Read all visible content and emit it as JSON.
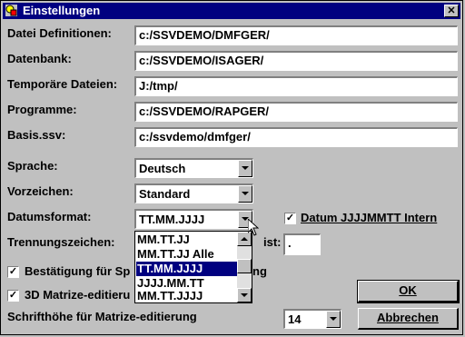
{
  "window": {
    "title": "Einstellungen",
    "close_glyph": "✕"
  },
  "paths": {
    "datei_definitionen": {
      "label": "Datei Definitionen:",
      "value": "c:/SSVDEMO/DMFGER/"
    },
    "datenbank": {
      "label": "Datenbank:",
      "value": "c:/SSVDEMO/ISAGER/"
    },
    "temporaere_dateien": {
      "label": "Temporäre Dateien:",
      "value": "J:/tmp/"
    },
    "programme": {
      "label": "Programme:",
      "value": "c:/SSVDEMO/RAPGER/"
    },
    "basis_ssv": {
      "label": "Basis.ssv:",
      "value": "c:/ssvdemo/dmfger/"
    }
  },
  "sprache": {
    "label": "Sprache:",
    "value": "Deutsch"
  },
  "vorzeichen": {
    "label": "Vorzeichen:",
    "value": "Standard"
  },
  "datumsformat": {
    "label": "Datumsformat:",
    "value": "TT.MM.JJJJ",
    "options": [
      "MM.TT.JJ",
      "MM.TT.JJ Alle",
      "TT.MM.JJJJ",
      "JJJJ.MM.TT",
      "MM.TT.JJJJ"
    ],
    "selected_index": 2
  },
  "datum_intern": {
    "label": "Datum JJJJMMTT Intern",
    "checked": true,
    "check_glyph": "✓"
  },
  "trennungszeichen": {
    "label": "Trennungszeichen:",
    "ist_label": "ist:",
    "ist_value": "."
  },
  "bestaetigung": {
    "label_part1": "Bestätigung für Sp",
    "label_part2": "ng",
    "checked": true,
    "check_glyph": "✓"
  },
  "matrize_3d": {
    "label": "3D Matrize-editieru",
    "checked": true,
    "check_glyph": "✓"
  },
  "schrifthoehe": {
    "label": "Schrifthöhe für Matrize-editierung",
    "value": "14"
  },
  "buttons": {
    "ok": "OK",
    "abbrechen": "Abbrechen"
  },
  "colors": {
    "titlebar": "#000080",
    "face": "#c0c0c0",
    "selection": "#000080"
  }
}
